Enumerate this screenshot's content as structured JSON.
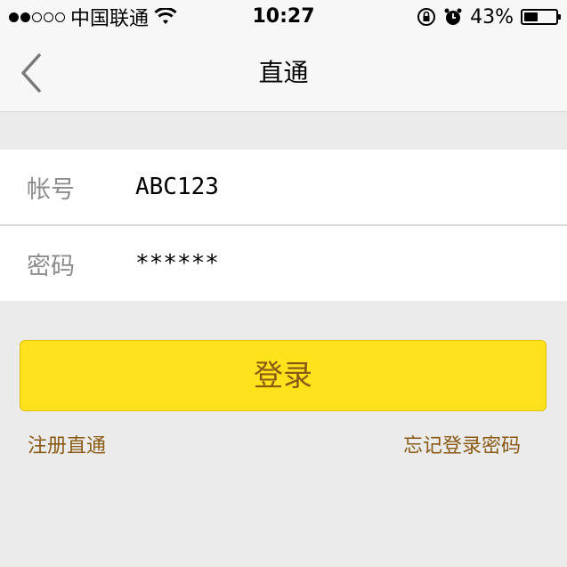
{
  "status_bar": {
    "carrier": "中国联通",
    "time": "10:27",
    "battery_percent": "43%",
    "battery_level": 0.43,
    "signal_filled": 2,
    "signal_total": 5
  },
  "nav": {
    "title": "直通",
    "back_icon": "chevron-left-icon"
  },
  "form": {
    "account": {
      "label": "帐号",
      "value": "ABC123"
    },
    "password": {
      "label": "密码",
      "value": "******"
    }
  },
  "actions": {
    "login_label": "登录",
    "register_label": "注册直通",
    "forgot_label": "忘记登录密码"
  },
  "colors": {
    "accent": "#fde21c",
    "link": "#8a5a14",
    "background": "#ebebeb"
  }
}
